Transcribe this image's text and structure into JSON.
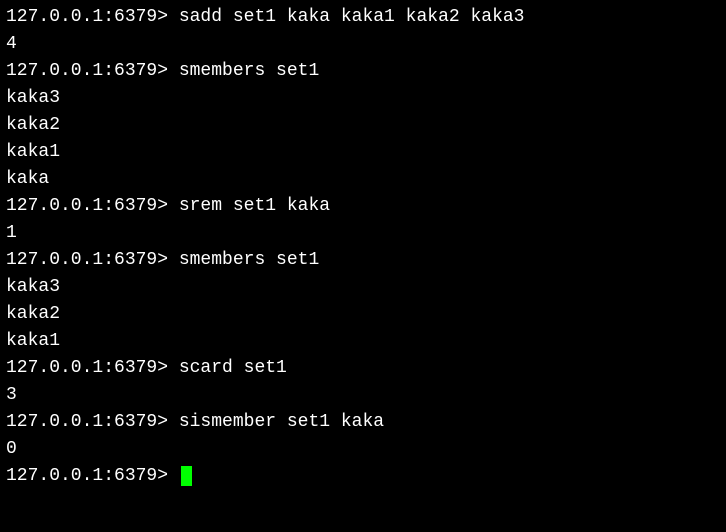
{
  "prompt": "127.0.0.1:6379> ",
  "lines": [
    {
      "prompt": true,
      "cmd": "sadd set1 kaka kaka1 kaka2 kaka3"
    },
    {
      "prompt": false,
      "text": "4"
    },
    {
      "prompt": true,
      "cmd": "smembers set1"
    },
    {
      "prompt": false,
      "text": "kaka3"
    },
    {
      "prompt": false,
      "text": "kaka2"
    },
    {
      "prompt": false,
      "text": "kaka1"
    },
    {
      "prompt": false,
      "text": "kaka"
    },
    {
      "prompt": true,
      "cmd": "srem set1 kaka"
    },
    {
      "prompt": false,
      "text": "1"
    },
    {
      "prompt": true,
      "cmd": "smembers set1"
    },
    {
      "prompt": false,
      "text": "kaka3"
    },
    {
      "prompt": false,
      "text": "kaka2"
    },
    {
      "prompt": false,
      "text": "kaka1"
    },
    {
      "prompt": true,
      "cmd": "scard set1"
    },
    {
      "prompt": false,
      "text": "3"
    },
    {
      "prompt": true,
      "cmd": "sismember set1 kaka"
    },
    {
      "prompt": false,
      "text": "0"
    },
    {
      "prompt": true,
      "cmd": "",
      "cursor": true
    }
  ]
}
